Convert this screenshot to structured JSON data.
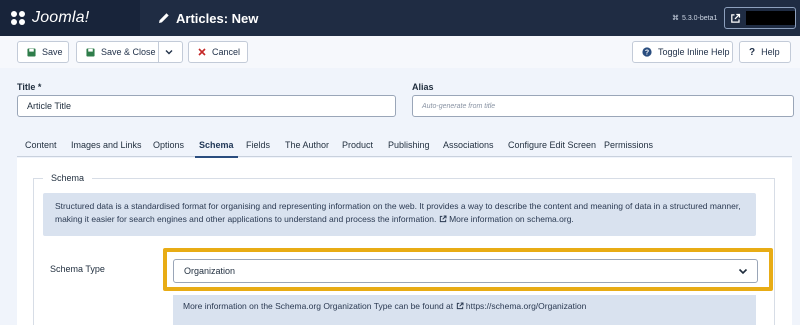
{
  "header": {
    "brand": "Joomla!",
    "page_title": "Articles: New",
    "version": "5.3.0-beta1"
  },
  "toolbar": {
    "save": "Save",
    "save_close": "Save & Close",
    "cancel": "Cancel",
    "toggle_help": "Toggle Inline Help",
    "help": "Help"
  },
  "form": {
    "title_label": "Title *",
    "title_value": "Article Title",
    "alias_label": "Alias",
    "alias_placeholder": "Auto-generate from title"
  },
  "tabs": [
    "Content",
    "Images and Links",
    "Options",
    "Schema",
    "Fields",
    "The Author",
    "Product",
    "Publishing",
    "Associations",
    "Configure Edit Screen",
    "Permissions"
  ],
  "active_tab": "Schema",
  "schema": {
    "legend": "Schema",
    "info_text": "Structured data is a standardised format for organising and representing information on the web. It provides a way to describe the content and meaning of data in a structured manner, making it easier for search engines and other applications to understand and process the information.",
    "info_link": "More information on schema.org.",
    "type_label": "Schema Type",
    "type_value": "Organization",
    "type_help": "More information on the Schema.org Organization Type can be found at",
    "type_help_link": "https://schema.org/Organization"
  },
  "colors": {
    "header_bg": "#1f2c43",
    "highlight": "#e8ac15",
    "save_icon": "#2f7d4a",
    "cancel_icon": "#c52827"
  }
}
